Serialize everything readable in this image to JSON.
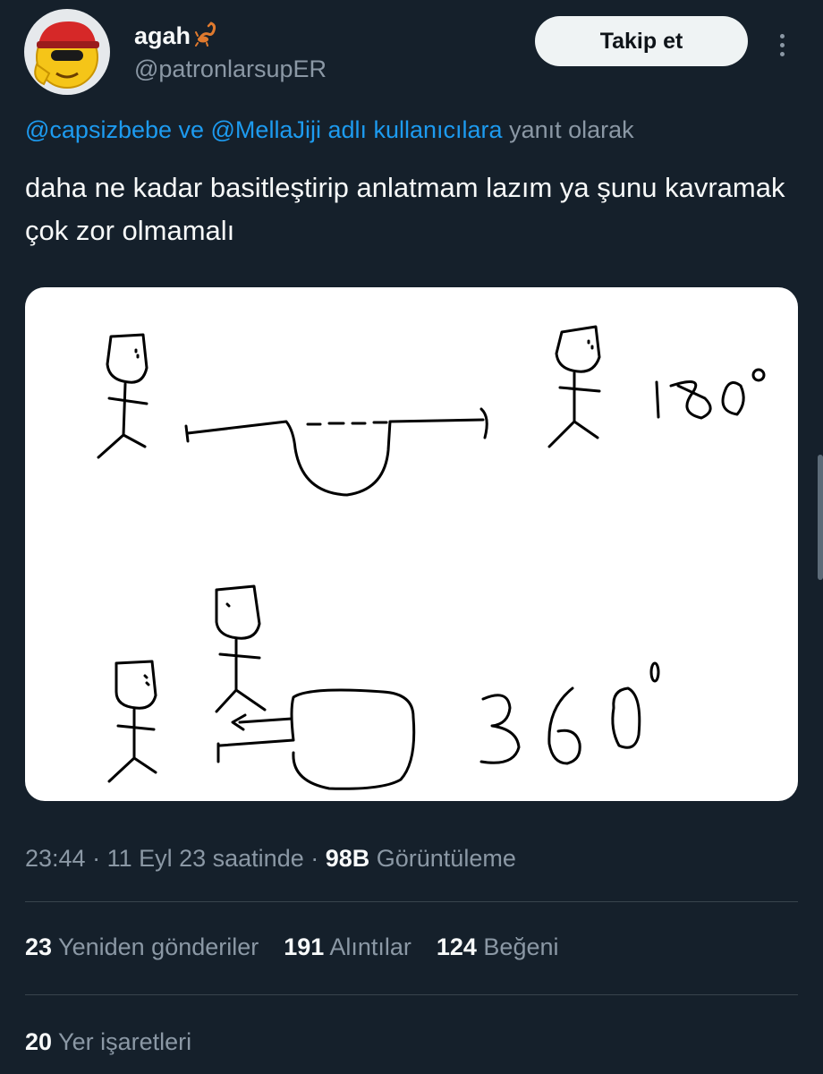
{
  "user": {
    "name": "agah",
    "handle": "@patronlarsupER"
  },
  "follow_label": "Takip et",
  "reply": {
    "users": "@capsizbebe ve @MellaJiji adlı kullanıcılara",
    "suffix": " yanıt olarak"
  },
  "tweet_text": "daha ne kadar basitleştirip anlatmam lazım ya şunu kavramak çok zor olmamalı",
  "drawing": {
    "label_top": "180°",
    "label_bottom": "360°"
  },
  "meta": {
    "time": "23:44",
    "sep1": " · ",
    "date": "11 Eyl 23 saatinde",
    "sep2": " · ",
    "views_count": "98B",
    "views_label": " Görüntüleme"
  },
  "stats": {
    "retweets_count": "23",
    "retweets_label": " Yeniden gönderiler",
    "quotes_count": "191",
    "quotes_label": " Alıntılar",
    "likes_count": "124",
    "likes_label": " Beğeni"
  },
  "bookmarks": {
    "count": "20",
    "label": " Yer işaretleri"
  }
}
